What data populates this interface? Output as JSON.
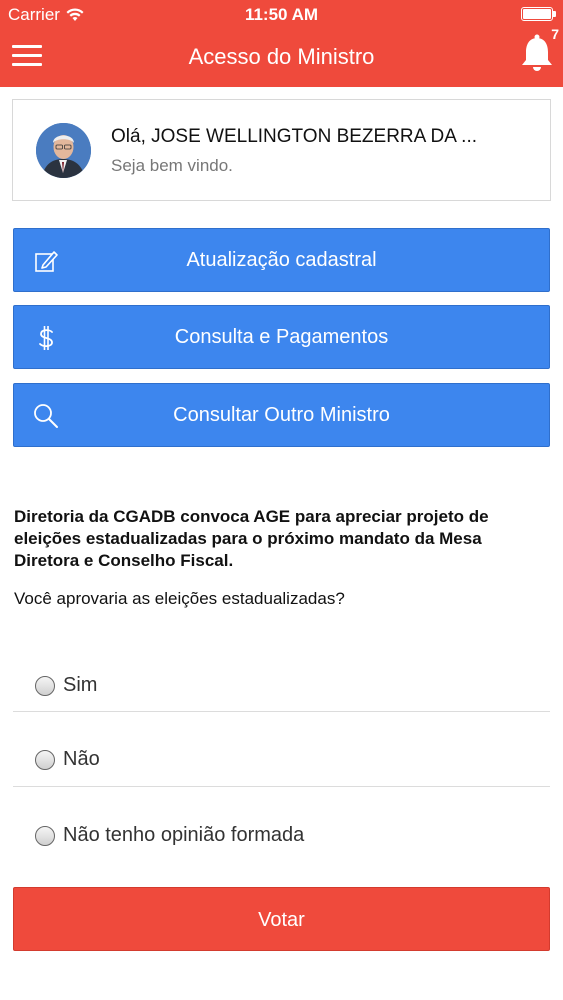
{
  "status_bar": {
    "carrier": "Carrier",
    "time": "11:50 AM"
  },
  "header": {
    "title": "Acesso do Ministro",
    "notification_count": "7"
  },
  "user": {
    "greeting": "Olá, JOSE WELLINGTON BEZERRA DA ...",
    "welcome": "Seja bem vindo."
  },
  "actions": [
    {
      "label": "Atualização cadastral",
      "icon": "edit-icon"
    },
    {
      "label": "Consulta e Pagamentos",
      "icon": "dollar-icon"
    },
    {
      "label": "Consultar Outro Ministro",
      "icon": "search-icon"
    }
  ],
  "poll": {
    "title": "Diretoria da CGADB convoca AGE para apreciar projeto de eleições estadualizadas para o próximo mandato da Mesa Diretora e Conselho Fiscal.",
    "question": "Você aprovaria as eleições estadualizadas?",
    "options": [
      "Sim",
      "Não",
      "Não tenho opinião formada"
    ],
    "submit_label": "Votar"
  },
  "colors": {
    "header": "#ef4a3c",
    "button": "#3d86ee",
    "vote": "#ef4a3c"
  }
}
